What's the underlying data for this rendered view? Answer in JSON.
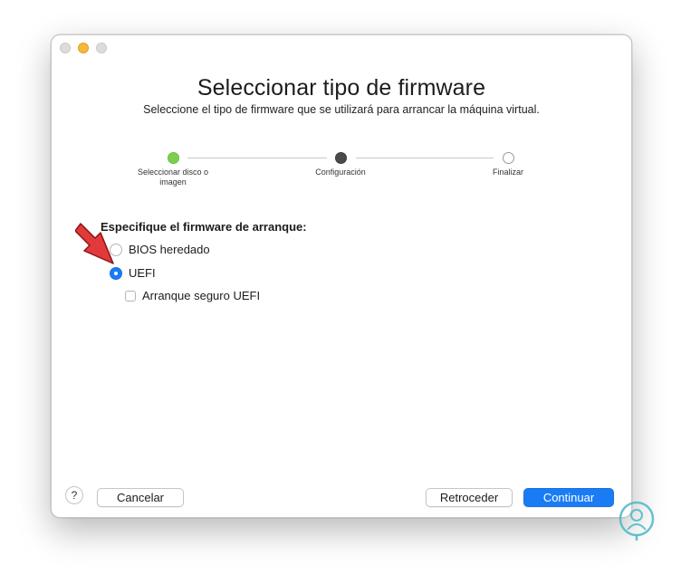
{
  "window": {
    "title": "Seleccionar tipo de firmware",
    "subtitle": "Seleccione el tipo de firmware que se utilizará para arrancar la máquina virtual."
  },
  "steps": [
    {
      "label": "Seleccionar disco o imagen",
      "state": "done"
    },
    {
      "label": "Configuración",
      "state": "current"
    },
    {
      "label": "Finalizar",
      "state": "pending"
    }
  ],
  "firmware": {
    "section_label": "Especifique el firmware de arranque:",
    "options": [
      {
        "label": "BIOS heredado",
        "selected": false
      },
      {
        "label": "UEFI",
        "selected": true
      }
    ],
    "secure_boot": {
      "label": "Arranque seguro UEFI",
      "checked": false
    }
  },
  "buttons": {
    "help": "?",
    "cancel": "Cancelar",
    "back": "Retroceder",
    "continue": "Continuar"
  },
  "colors": {
    "accent": "#1a7cf5",
    "step_done": "#7ccf4c",
    "step_current": "#4a4a4a",
    "arrow": "#e23a3a"
  }
}
